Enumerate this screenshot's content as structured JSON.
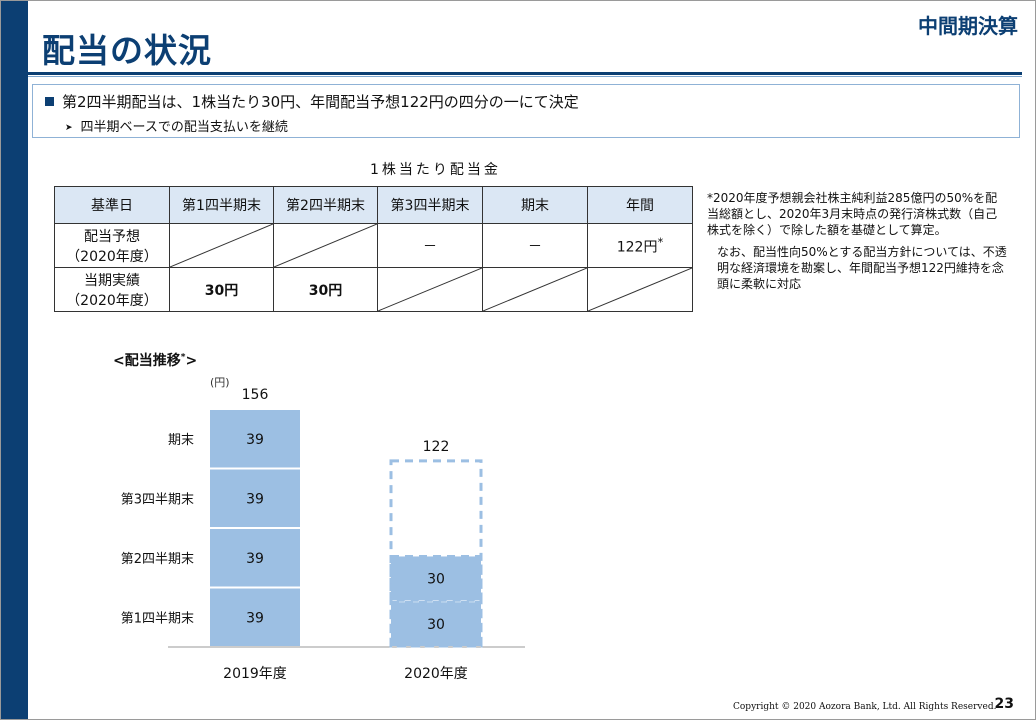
{
  "header": {
    "title": "配当の状況",
    "badge": "中間期決算"
  },
  "summary": {
    "line1": "第2四半期配当は、1株当たり30円、年間配当予想122円の四分の一にて決定",
    "line2": "四半期ベースでの配当支払いを継続"
  },
  "table": {
    "caption": "1株当たり配当金",
    "headers": [
      "基準日",
      "第1四半期末",
      "第2四半期末",
      "第3四半期末",
      "期末",
      "年間"
    ],
    "rows": [
      {
        "label1": "配当予想",
        "label2": "（2020年度）",
        "q3": "－",
        "end": "－",
        "annual": "122円",
        "mark": "*"
      },
      {
        "label1": "当期実績",
        "label2": "（2020年度）",
        "q1": "30円",
        "q2": "30円"
      }
    ]
  },
  "note": {
    "p1": "*2020年度予想親会社株主純利益285億円の50%を配当総額とし、2020年3月末時点の発行済株式数（自己株式を除く）で除した額を基礎として算定。",
    "p2": "なお、配当性向50%とする配当方針については、不透明な経済環境を勘案し、年間配当予想122円維持を念頭に柔軟に対応"
  },
  "chart_title": {
    "text": "<配当推移",
    "mark": "*",
    "close": ">"
  },
  "chart_data": {
    "type": "bar",
    "stacked": true,
    "unit": "(円)",
    "categories": [
      "2019年度",
      "2020年度"
    ],
    "segments": [
      "第1四半期末",
      "第2四半期末",
      "第3四半期末",
      "期末"
    ],
    "series": [
      {
        "values": [
          39,
          39,
          39,
          39
        ]
      },
      {
        "values": [
          30,
          30,
          null,
          null
        ]
      }
    ],
    "totals": [
      156,
      122
    ],
    "forecast_total_2020": 122,
    "colors": {
      "bar": "#9cbfe3",
      "dash": "#9cbfe3",
      "axis": "#9a9a9a"
    }
  },
  "footer": {
    "copyright": "Copyright © 2020 Aozora Bank, Ltd.  All Rights Reserved.",
    "page": "23"
  }
}
